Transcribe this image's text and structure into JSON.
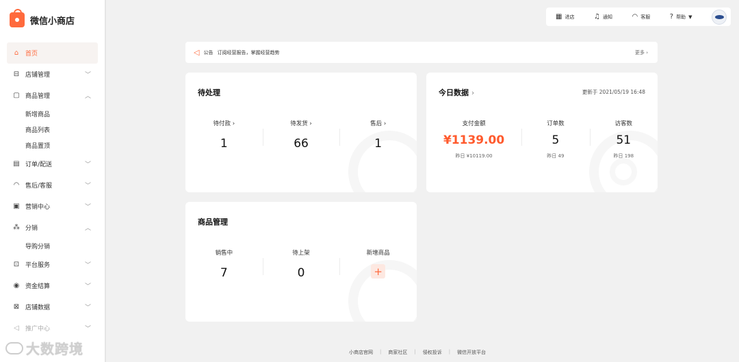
{
  "brand": {
    "name": "微信小商店"
  },
  "sidebar": {
    "items": [
      {
        "label": "首页",
        "icon": "home-icon",
        "active": true
      },
      {
        "label": "店铺管理",
        "icon": "store-icon",
        "expanded": false
      },
      {
        "label": "商品管理",
        "icon": "bag-icon",
        "expanded": true,
        "children": [
          "新增商品",
          "商品列表",
          "商品置顶"
        ]
      },
      {
        "label": "订单/配送",
        "icon": "clipboard-icon",
        "expanded": false
      },
      {
        "label": "售后/客服",
        "icon": "headset-icon",
        "expanded": false
      },
      {
        "label": "营销中心",
        "icon": "ticket-icon",
        "expanded": false
      },
      {
        "label": "分销",
        "icon": "share-icon",
        "expanded": true,
        "children": [
          "导购分销"
        ]
      },
      {
        "label": "平台服务",
        "icon": "briefcase-icon",
        "expanded": false
      },
      {
        "label": "资金结算",
        "icon": "coin-icon",
        "expanded": false
      },
      {
        "label": "店铺数据",
        "icon": "chart-icon",
        "expanded": false
      },
      {
        "label": "推广中心",
        "icon": "megaphone-icon",
        "expanded": false
      }
    ]
  },
  "watermark": {
    "text": "大数跨境"
  },
  "topbar": {
    "store": "进店",
    "notify": "通知",
    "service": "客服",
    "help": "帮助"
  },
  "notice": {
    "tag": "公告",
    "text": "订阅经营报告，掌握经营趋势",
    "more": "更多"
  },
  "pending": {
    "title": "待处理",
    "stats": [
      {
        "label": "待付款",
        "value": "1"
      },
      {
        "label": "待发货",
        "value": "66"
      },
      {
        "label": "售后",
        "value": "1"
      }
    ]
  },
  "today": {
    "title": "今日数据",
    "updated": "更新于 2021/05/19 16:48",
    "stats": [
      {
        "label": "支付金额",
        "value": "¥1139.00",
        "sub": "昨日 ¥10119.00"
      },
      {
        "label": "订单数",
        "value": "5",
        "sub": "昨日 49"
      },
      {
        "label": "访客数",
        "value": "51",
        "sub": "昨日 198"
      }
    ]
  },
  "goods": {
    "title": "商品管理",
    "stats": [
      {
        "label": "销售中",
        "value": "7"
      },
      {
        "label": "待上架",
        "value": "0"
      },
      {
        "label": "新增商品",
        "value": "+"
      }
    ]
  },
  "footer": [
    "小商店官网",
    "商家社区",
    "侵权投诉",
    "微信开放平台"
  ],
  "colors": {
    "accent": "#ff6a3d",
    "price": "#ff5a2d",
    "background": "#f1f1f1"
  }
}
